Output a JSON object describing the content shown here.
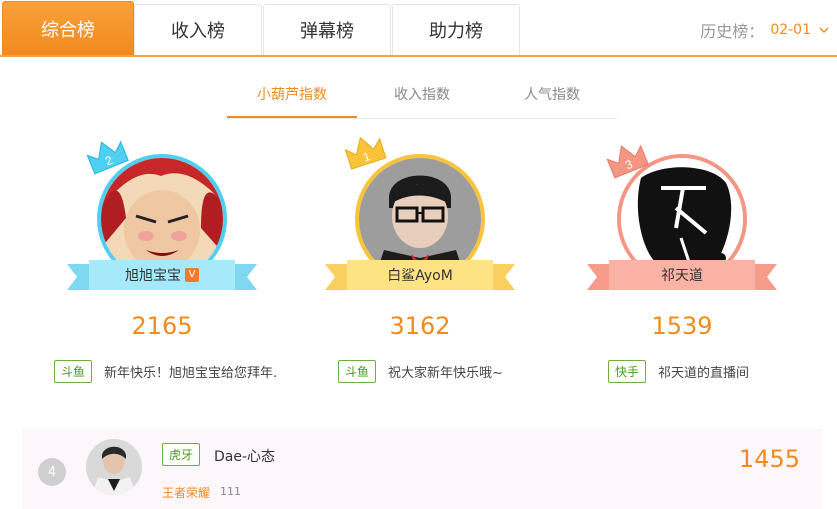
{
  "tabs": [
    {
      "label": "综合榜",
      "active": true
    },
    {
      "label": "收入榜",
      "active": false
    },
    {
      "label": "弹幕榜",
      "active": false
    },
    {
      "label": "助力榜",
      "active": false
    }
  ],
  "history": {
    "label": "历史榜：",
    "value": "02-01"
  },
  "subtabs": [
    {
      "label": "小葫芦指数",
      "active": true
    },
    {
      "label": "收入指数",
      "active": false
    },
    {
      "label": "人气指数",
      "active": false
    }
  ],
  "podium": [
    {
      "rank": "2",
      "name": "旭旭宝宝",
      "verified": "V",
      "score": "2165",
      "platform": "斗鱼",
      "desc": "新年快乐！旭旭宝宝给您拜年.",
      "color": "#4fd0f2",
      "ribbon": "#a5e9fb"
    },
    {
      "rank": "1",
      "name": "白鲨AyoM",
      "score": "3162",
      "platform": "斗鱼",
      "desc": "祝大家新年快乐哦~",
      "color": "#f9c33a",
      "ribbon": "#fde384"
    },
    {
      "rank": "3",
      "name": "祁天道",
      "score": "1539",
      "platform": "快手",
      "desc": "祁天道的直播间",
      "color": "#f59583",
      "ribbon": "#fab2a5"
    }
  ],
  "row4": {
    "rank": "4",
    "platform": "虎牙",
    "name": "Dae-心态",
    "game": "王者荣耀",
    "count": "111",
    "score": "1455"
  },
  "colors": {
    "accent": "#f08b1d",
    "platform_green": "#6ab23c"
  }
}
